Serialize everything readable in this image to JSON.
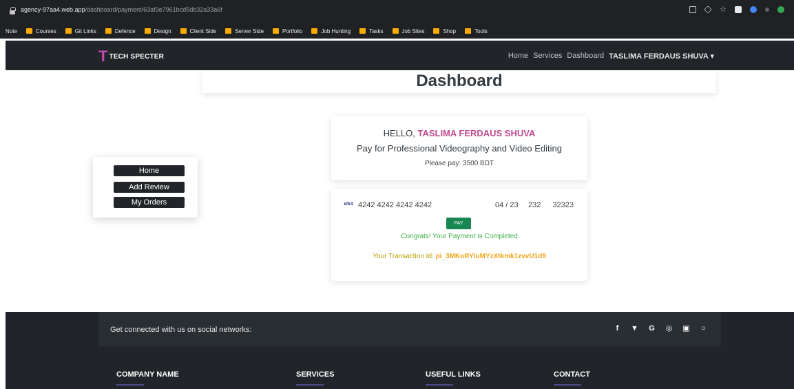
{
  "browser": {
    "url_host": "agency-97aa4.web.app",
    "url_path": "/dashboard/payment/63af3e7961bcd5db32a33a6f",
    "bookmarks": [
      "Note",
      "Courses",
      "Git Links",
      "Defence",
      "Design",
      "Client Side",
      "Server Side",
      "Portfolio",
      "Job Hunting",
      "Tasks",
      "Job Sites",
      "Shop",
      "Tools"
    ]
  },
  "nav": {
    "logo_letter": "T",
    "brand": "TECH SPECTER",
    "links": [
      "Home",
      "Services",
      "Dashboard"
    ],
    "user": "TASLIMA FERDAUS SHUVA"
  },
  "page": {
    "title": "Dashboard"
  },
  "sidebar": {
    "items": [
      "Home",
      "Add Review",
      "My Orders"
    ]
  },
  "summary": {
    "hello": "HELLO,",
    "name": "TASLIMA FERDAUS SHUVA",
    "service": "Pay for Professional Videography and Video Editing",
    "amount": "Please pay: 3500 BDT"
  },
  "payment": {
    "brand": "VISA",
    "card_number": "4242 4242 4242 4242",
    "expiry": "04 / 23",
    "cvc": "232",
    "zip": "32323",
    "pay_label": "PAY",
    "success": "Congrats! Your Payment is Completed",
    "txn_label": "Your Transaction Id:",
    "txn_id": "pi_3MKoRYIuMYzXtkmk1zvvU1d9"
  },
  "footer": {
    "social_text": "Get connected with us on social networks:",
    "social_icons": [
      "f",
      "🐦",
      "G",
      "◎",
      "in",
      "○"
    ],
    "columns": [
      "COMPANY NAME",
      "SERVICES",
      "USEFUL LINKS",
      "CONTACT"
    ]
  },
  "colors": {
    "accent": "#c04a90",
    "success": "#198754",
    "dark": "#212529"
  }
}
